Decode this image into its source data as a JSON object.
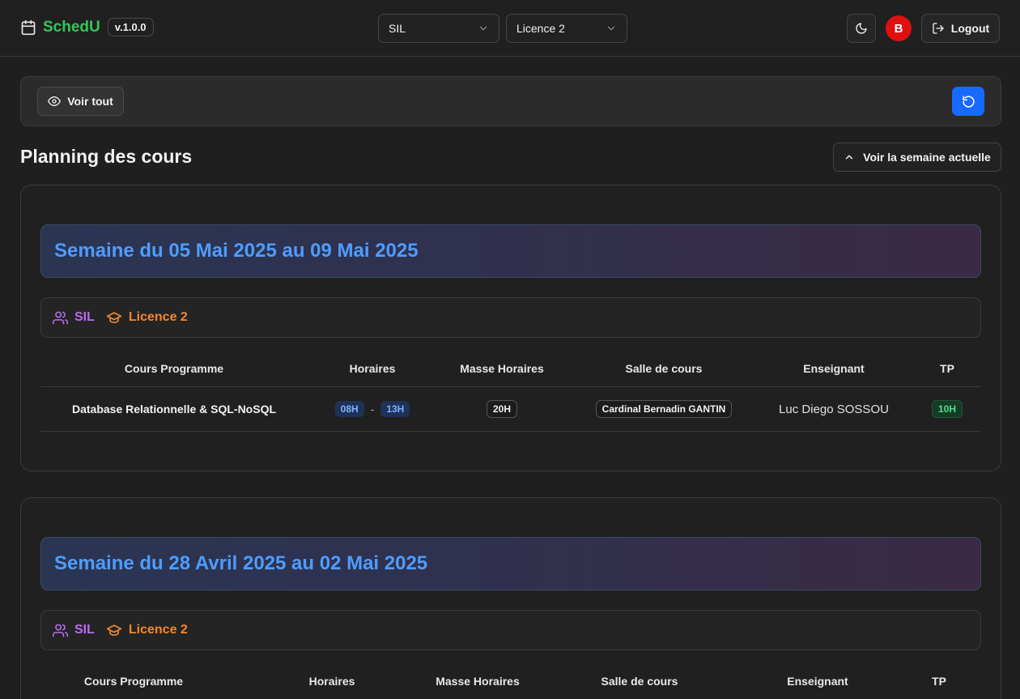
{
  "header": {
    "brand": "SchedU",
    "version": "v.1.0.0",
    "filiere_select": "SIL",
    "niveau_select": "Licence 2",
    "avatar_initial": "B",
    "logout_label": "Logout"
  },
  "toolbar": {
    "voir_tout_label": "Voir tout"
  },
  "page": {
    "title": "Planning des cours",
    "current_week_label": "Voir la semaine actuelle"
  },
  "table_headers": [
    "Cours Programme",
    "Horaires",
    "Masse Horaires",
    "Salle de cours",
    "Enseignant",
    "TP"
  ],
  "weeks": [
    {
      "title": "Semaine du 05 Mai 2025 au 09 Mai 2025",
      "filiere": "SIL",
      "niveau": "Licence 2",
      "rows": [
        {
          "cours": "Database Relationnelle & SQL-NoSQL",
          "debut": "08H",
          "separator": "-",
          "fin": "13H",
          "masse": "20H",
          "salle": "Cardinal Bernadin GANTIN",
          "enseignant": "Luc Diego SOSSOU",
          "tp": "10H"
        }
      ]
    },
    {
      "title": "Semaine du 28 Avril 2025 au 02 Mai 2025",
      "filiere": "SIL",
      "niveau": "Licence 2",
      "rows": []
    }
  ],
  "colors": {
    "brand": "#34c759",
    "accent_blue": "#1769ff",
    "week_title": "#4f9cff",
    "filiere": "#b96cf4",
    "niveau": "#f2882c",
    "tp_badge": "#4ee08a",
    "avatar": "#e01010"
  }
}
